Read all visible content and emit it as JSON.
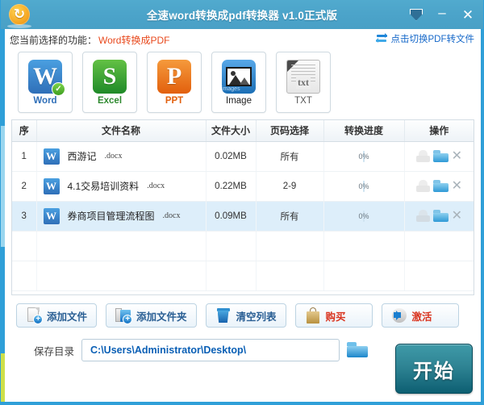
{
  "window": {
    "title": "全速word转换成pdf转换器 v1.0正式版",
    "logo_icon": "refresh-circle-logo",
    "controls": {
      "tray": "▼",
      "minimize": "–",
      "close": "✕"
    }
  },
  "function_bar": {
    "label": "您当前选择的功能：",
    "value": "Word转换成PDF",
    "switch_link": "点击切换PDF转文件",
    "switch_icon": "swap-arrows-icon"
  },
  "format_tiles": [
    {
      "label": "Word",
      "glyph": "W",
      "selected": true,
      "icon": "word-icon"
    },
    {
      "label": "Excel",
      "glyph": "S",
      "selected": false,
      "icon": "excel-icon"
    },
    {
      "label": "PPT",
      "glyph": "P",
      "selected": false,
      "icon": "ppt-icon"
    },
    {
      "label": "Image",
      "glyph": "",
      "selected": false,
      "icon": "image-icon",
      "mini_label": "images"
    },
    {
      "label": "TXT",
      "glyph": "txt",
      "selected": false,
      "icon": "txt-icon"
    }
  ],
  "table": {
    "headers": [
      "序",
      "文件名称",
      "文件大小",
      "页码选择",
      "转换进度",
      "操作"
    ],
    "rows": [
      {
        "index": "1",
        "name": "西游记",
        "ext": ".docx",
        "size": "0.02MB",
        "pages": "所有",
        "progress": "0%",
        "selected": false
      },
      {
        "index": "2",
        "name": "4.1交易培训资料",
        "ext": ".docx",
        "size": "0.22MB",
        "pages": "2-9",
        "progress": "0%",
        "selected": false
      },
      {
        "index": "3",
        "name": "券商项目管理流程图",
        "ext": ".docx",
        "size": "0.09MB",
        "pages": "所有",
        "progress": "0%",
        "selected": true
      }
    ],
    "empty_rows": 2,
    "ops_icons": [
      "preview-icon",
      "open-folder-icon",
      "remove-icon"
    ]
  },
  "buttons": [
    {
      "label": "添加文件",
      "icon": "add-file-icon",
      "style": "blue"
    },
    {
      "label": "添加文件夹",
      "icon": "add-folder-icon",
      "style": "blue"
    },
    {
      "label": "清空列表",
      "icon": "trash-icon",
      "style": "blue"
    },
    {
      "label": "购买",
      "icon": "shopping-bag-icon",
      "style": "red"
    },
    {
      "label": "激活",
      "icon": "activate-icon",
      "style": "red"
    }
  ],
  "save": {
    "label": "保存目录",
    "path": "C:\\Users\\Administrator\\Desktop\\",
    "placeholder": "C:\\Users\\Administrator\\Desktop\\",
    "browse_icon": "folder-browse-icon"
  },
  "start": {
    "label": "开始"
  },
  "colors": {
    "titlebar": "#4ba3c9",
    "border": "#2f9fd8",
    "accent_red": "#e8491d",
    "link_blue": "#1668c9",
    "start_teal": "#2f8494",
    "path_blue": "#0a5fb5"
  }
}
